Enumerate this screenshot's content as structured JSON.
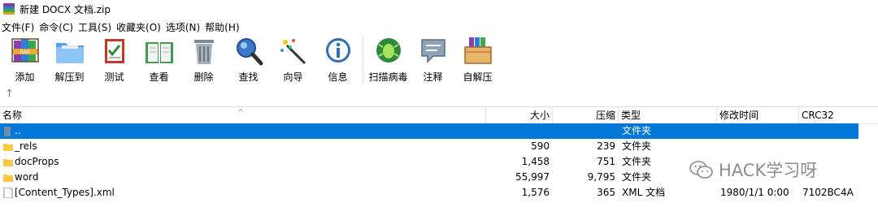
{
  "window": {
    "title": "新建 DOCX 文档.zip"
  },
  "menu": [
    "文件(F)",
    "命令(C)",
    "工具(S)",
    "收藏夹(O)",
    "选项(N)",
    "帮助(H)"
  ],
  "toolbar": {
    "add": "添加",
    "extract": "解压到",
    "test": "测试",
    "view": "查看",
    "delete": "删除",
    "find": "查找",
    "wizard": "向导",
    "info": "信息",
    "scan": "扫描病毒",
    "comment": "注释",
    "sfx": "自解压"
  },
  "columns": {
    "name": "名称",
    "size": "大小",
    "packed": "压缩",
    "type": "类型",
    "modified": "修改时间",
    "crc": "CRC32"
  },
  "files": [
    {
      "name": "..",
      "size": "",
      "packed": "",
      "type": "文件夹",
      "modified": "",
      "crc": "",
      "icon": "folder-up-icon",
      "selected": true
    },
    {
      "name": "_rels",
      "size": "590",
      "packed": "239",
      "type": "文件夹",
      "modified": "",
      "crc": "",
      "icon": "folder-icon"
    },
    {
      "name": "docProps",
      "size": "1,458",
      "packed": "751",
      "type": "文件夹",
      "modified": "",
      "crc": "",
      "icon": "folder-icon"
    },
    {
      "name": "word",
      "size": "55,997",
      "packed": "9,795",
      "type": "文件夹",
      "modified": "",
      "crc": "",
      "icon": "folder-icon"
    },
    {
      "name": "[Content_Types].xml",
      "size": "1,576",
      "packed": "365",
      "type": "XML 文档",
      "modified": "1980/1/1 0:00",
      "crc": "7102BC4A",
      "icon": "file-icon"
    }
  ],
  "watermark": {
    "text": "HACK学习呀"
  },
  "colors": {
    "selection": "#0078d7",
    "folder": "#f7c948"
  }
}
